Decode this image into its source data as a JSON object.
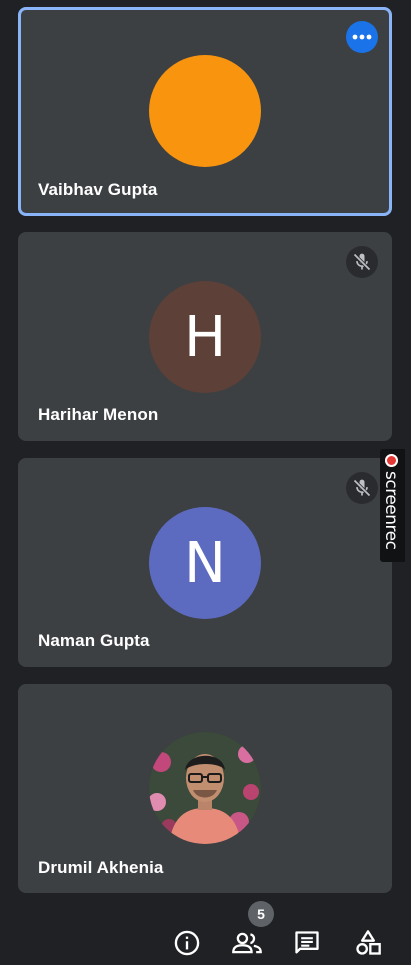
{
  "participants": [
    {
      "name": "Vaibhav Gupta",
      "avatar_type": "color-circle",
      "avatar_initial": "",
      "avatar_color": "#f9940e",
      "muted": false,
      "active_speaker": true,
      "menu_icon": "more-horizontal-icon"
    },
    {
      "name": "Harihar Menon",
      "avatar_type": "initial",
      "avatar_initial": "H",
      "avatar_color": "#5d4037",
      "muted": true,
      "active_speaker": false,
      "menu_icon": "mic-off-icon"
    },
    {
      "name": "Naman Gupta",
      "avatar_type": "initial",
      "avatar_initial": "N",
      "avatar_color": "#5c6bc0",
      "muted": true,
      "active_speaker": false,
      "menu_icon": "mic-off-icon"
    },
    {
      "name": "Drumil Akhenia",
      "avatar_type": "photo",
      "avatar_initial": "",
      "avatar_color": "#d9898a",
      "muted": false,
      "active_speaker": false,
      "menu_icon": ""
    }
  ],
  "screenrec": {
    "label": "screenrec",
    "icon": "record-dot-icon"
  },
  "toolbar": {
    "info_icon": "info-icon",
    "people_icon": "people-icon",
    "people_count": "5",
    "chat_icon": "chat-icon",
    "activities_icon": "activities-icon"
  },
  "colors": {
    "background": "#202124",
    "tile": "#3c4043",
    "active_border": "#8ab4f8",
    "accent": "#1a73e8"
  }
}
